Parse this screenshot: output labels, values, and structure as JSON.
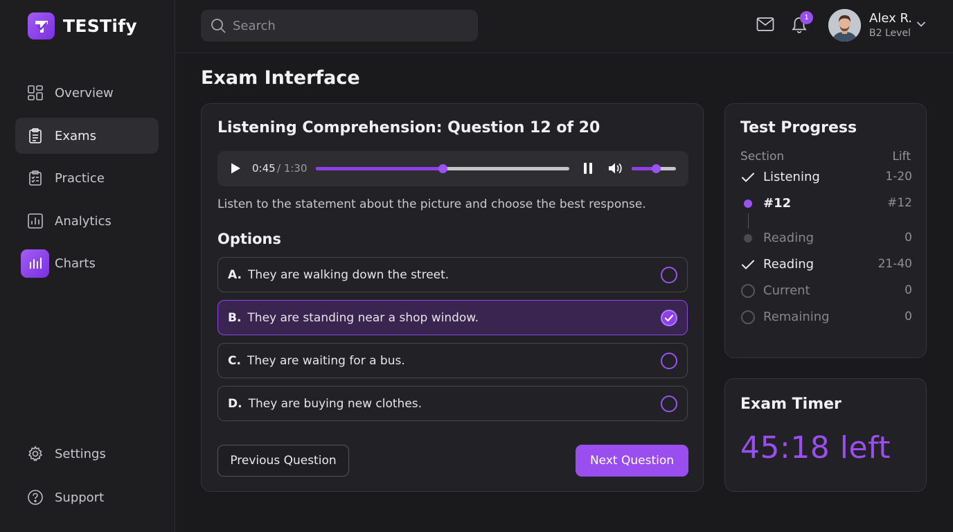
{
  "app": {
    "name": "TESTify"
  },
  "sidebar": {
    "items": [
      {
        "label": "Overview",
        "icon": "grid-icon"
      },
      {
        "label": "Exams",
        "icon": "clipboard-icon",
        "active": true
      },
      {
        "label": "Practice",
        "icon": "checklist-icon"
      },
      {
        "label": "Analytics",
        "icon": "bar-chart-icon"
      },
      {
        "label": "Charts",
        "icon": "charts-icon"
      }
    ],
    "bottom": [
      {
        "label": "Settings",
        "icon": "gear-icon"
      },
      {
        "label": "Support",
        "icon": "help-icon"
      }
    ]
  },
  "topbar": {
    "search_placeholder": "Search",
    "notification_count": "1",
    "user": {
      "name": "Alex R.",
      "level": "B2 Level"
    }
  },
  "page": {
    "title": "Exam Interface"
  },
  "question": {
    "title": "Listening Comprehension: Question 12 of 20",
    "audio": {
      "current": "0:45",
      "total": " / 1:30",
      "progress": 0.5,
      "volume": 0.55
    },
    "instruction": "Listen to the statement about the picture and choose the best response.",
    "options_heading": "Options",
    "options": [
      {
        "letter": "A.",
        "text": "They are walking down the street.",
        "selected": false
      },
      {
        "letter": "B.",
        "text": "They are standing near a shop window.",
        "selected": true
      },
      {
        "letter": "C.",
        "text": "They are waiting for a bus.",
        "selected": false
      },
      {
        "letter": "D.",
        "text": "They are buying new clothes.",
        "selected": false
      }
    ],
    "prev_label": "Previous Question",
    "next_label": "Next Question"
  },
  "progress": {
    "title": "Test Progress",
    "col_section": "Section",
    "col_right": "Lift",
    "rows": [
      {
        "label": "Listening",
        "value": "1-20",
        "state": "done"
      },
      {
        "label": "#12",
        "value": "#12",
        "state": "current"
      },
      {
        "label": "Reading",
        "value": "0",
        "state": "pending"
      },
      {
        "label": "Reading",
        "value": "21-40",
        "state": "done"
      },
      {
        "label": "Current",
        "value": "0",
        "state": "empty"
      },
      {
        "label": "Remaining",
        "value": "0",
        "state": "empty"
      }
    ]
  },
  "timer": {
    "title": "Exam Timer",
    "value": "45:18 left"
  },
  "colors": {
    "accent": "#9a4ef0",
    "background": "#1a1a1d",
    "card": "#222226"
  }
}
